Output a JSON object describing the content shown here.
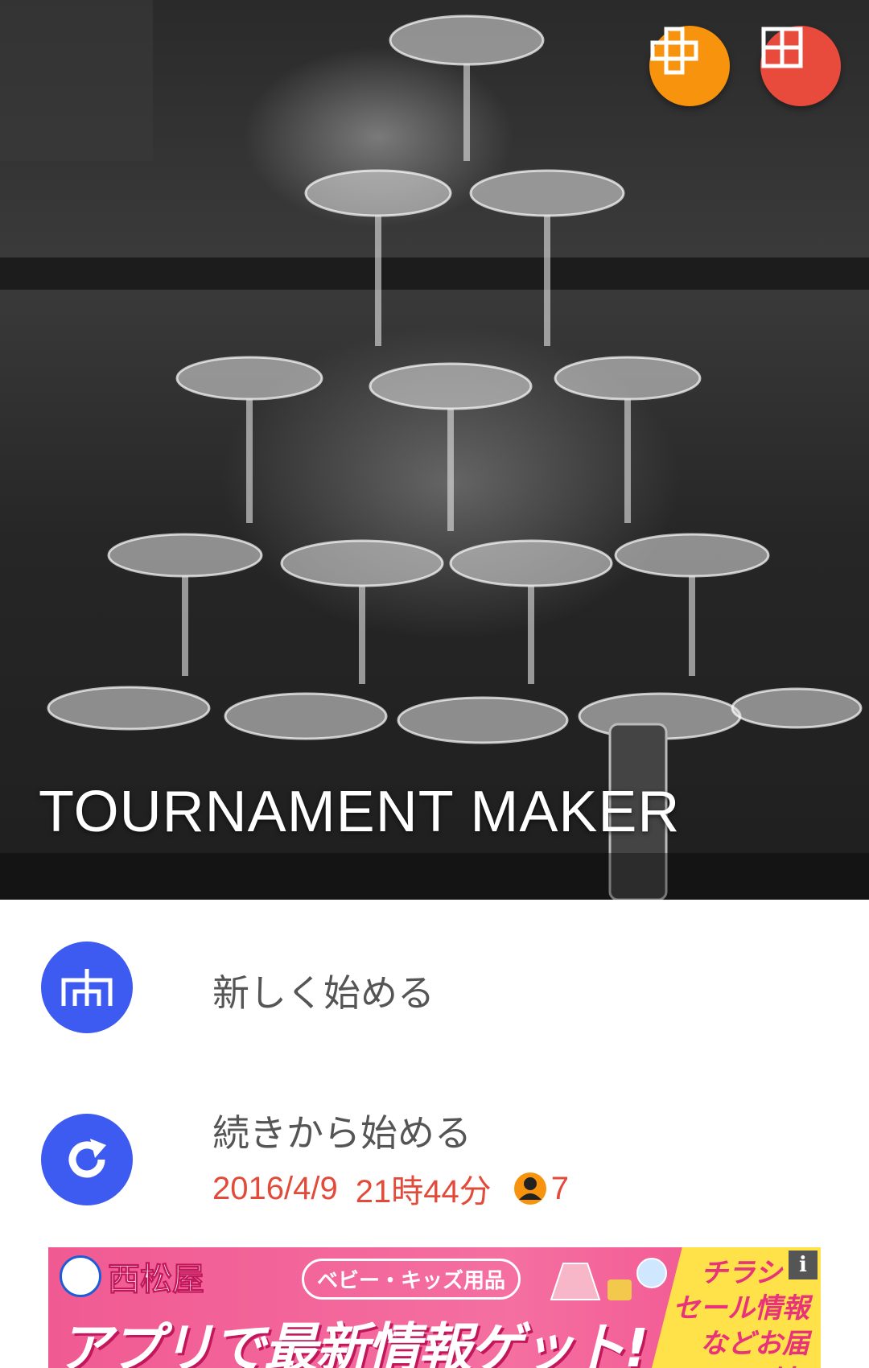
{
  "hero": {
    "title": "TOURNAMENT MAKER",
    "image": "champagne-tower-photo",
    "buttons": [
      {
        "name": "add-layout",
        "icon": "cross-grid-icon",
        "color": "#f7930c"
      },
      {
        "name": "grid-layout",
        "icon": "grid-icon",
        "color": "#e84a3c"
      }
    ]
  },
  "menu": {
    "new_start": {
      "label": "新しく始める",
      "icon": "tournament-bracket-icon"
    },
    "continue": {
      "label": "続きから始める",
      "date": "2016/4/9",
      "time": "21時44分",
      "player_count": "7",
      "player_icon": "person-icon"
    },
    "accent_color": "#3d5af1",
    "sub_color": "#e24a3a"
  },
  "ad": {
    "brand": "西松屋",
    "pill": "ベビー・キッズ用品",
    "headline": "アプリで最新情報ゲット!",
    "side_lines": [
      "チラシ・",
      "セール情報",
      "などお届け!"
    ],
    "info_badge": "i"
  }
}
